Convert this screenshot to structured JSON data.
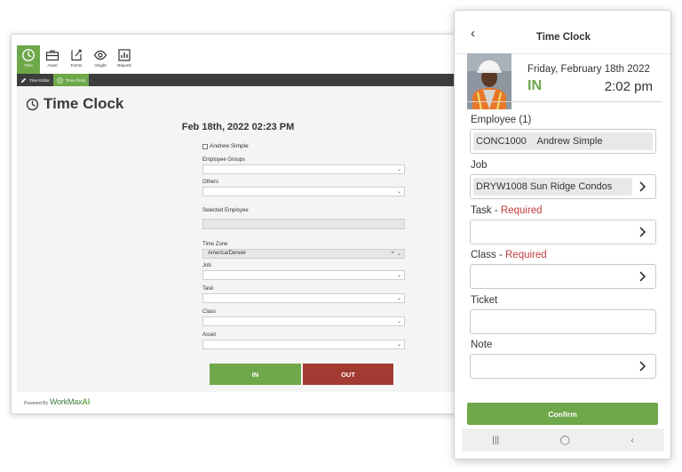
{
  "desktop": {
    "nav": [
      {
        "label": "Time",
        "icon": "clock-icon"
      },
      {
        "label": "Asset",
        "icon": "briefcase-icon"
      },
      {
        "label": "Forms",
        "icon": "forms-icon"
      },
      {
        "label": "Insight",
        "icon": "eye-icon"
      },
      {
        "label": "Reports",
        "icon": "reports-icon"
      }
    ],
    "subtabs": [
      {
        "label": "Time Editor",
        "icon": "pencil-icon"
      },
      {
        "label": "Time Clock",
        "icon": "clock-icon"
      }
    ],
    "page_title": "Time Clock",
    "datetime": "Feb 18th, 2022 02:23 PM",
    "checkbox_label": "Andrew Simple",
    "fields": {
      "employee_groups": "Employee Groups",
      "others": "Others",
      "selected_employee": "Selected Employee",
      "time_zone": "Time Zone",
      "time_zone_value": "America/Denver",
      "job": "Job",
      "task": "Task",
      "class": "Class",
      "asset": "Asset"
    },
    "in_label": "IN",
    "out_label": "OUT",
    "powered_by": "Powered By",
    "logo_text_a": "WorkMax",
    "logo_text_b": "AI"
  },
  "mobile": {
    "title": "Time Clock",
    "date": "Friday, February 18th 2022",
    "status": "IN",
    "time": "2:02 pm",
    "employee_label": "Employee (1)",
    "employee_value": "CONC1000    Andrew Simple",
    "job_label": "Job",
    "job_value": "DRYW1008 Sun Ridge Condos",
    "task_label": "Task",
    "class_label": "Class",
    "required_text": "Required",
    "ticket_label": "Ticket",
    "note_label": "Note",
    "confirm_label": "Confirm"
  },
  "colors": {
    "brand_green": "#6ea84a",
    "out_red": "#a33b33",
    "required_red": "#c23b3b",
    "dark_bar": "#3d3d3d"
  }
}
